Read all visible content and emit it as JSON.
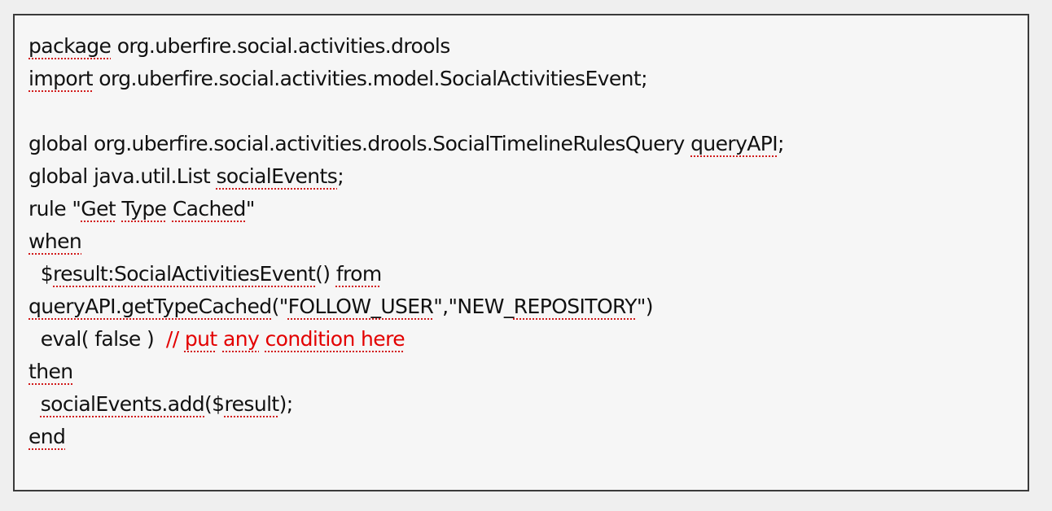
{
  "lines": [
    [
      {
        "t": "package",
        "sq": true
      },
      {
        "t": " org.uberfire.social.activities.drools"
      }
    ],
    [
      {
        "t": "import",
        "sq": true
      },
      {
        "t": " org.uberfire.social.activities.model.SocialActivitiesEvent;"
      }
    ],
    [],
    [
      {
        "t": "global org.uberfire.social.activities.drools.SocialTimelineRulesQuery "
      },
      {
        "t": "queryAPI",
        "sq": true
      },
      {
        "t": ";"
      }
    ],
    [
      {
        "t": "global java.util.List "
      },
      {
        "t": "socialEvents",
        "sq": true
      },
      {
        "t": ";"
      }
    ],
    [
      {
        "t": "rule \""
      },
      {
        "t": "Get",
        "sq": true
      },
      {
        "t": " "
      },
      {
        "t": "Type",
        "sq": true
      },
      {
        "t": " "
      },
      {
        "t": "Cached",
        "sq": true
      },
      {
        "t": "\""
      }
    ],
    [
      {
        "t": "when",
        "sq": true
      }
    ],
    [
      {
        "t": "  $"
      },
      {
        "t": "result:SocialActivitiesEvent",
        "sq": true
      },
      {
        "t": "() "
      },
      {
        "t": "from",
        "sq": true
      }
    ],
    [
      {
        "t": "queryAPI.getTypeCached",
        "sq": true
      },
      {
        "t": "(\""
      },
      {
        "t": "FOLLOW_USER",
        "sq": true
      },
      {
        "t": "\",\"NEW_"
      },
      {
        "t": "REPOSITORY",
        "sq": true
      },
      {
        "t": "\")"
      }
    ],
    [
      {
        "t": "  eval( false )  "
      },
      {
        "t": "// ",
        "c": true
      },
      {
        "t": "put",
        "c": true,
        "sq": true
      },
      {
        "t": " ",
        "c": true
      },
      {
        "t": "any",
        "c": true,
        "sq": true
      },
      {
        "t": " ",
        "c": true
      },
      {
        "t": "condition here",
        "c": true,
        "sq": true
      }
    ],
    [
      {
        "t": "then",
        "sq": true
      }
    ],
    [
      {
        "t": "  "
      },
      {
        "t": "socialEvents.add",
        "sq": true
      },
      {
        "t": "($"
      },
      {
        "t": "result",
        "sq": true
      },
      {
        "t": ");"
      }
    ],
    [
      {
        "t": "end",
        "sq": true
      }
    ]
  ]
}
